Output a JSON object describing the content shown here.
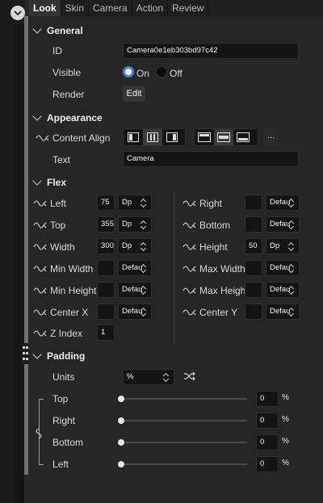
{
  "tabs": [
    "Look",
    "Skin",
    "Camera",
    "Action",
    "Review"
  ],
  "active_tab": "Look",
  "sections": {
    "general": "General",
    "appearance": "Appearance",
    "flex": "Flex",
    "padding": "Padding"
  },
  "general": {
    "id_label": "ID",
    "id_value": "Camera0e1eb303bd97c42",
    "visible_label": "Visible",
    "on_label": "On",
    "off_label": "Off",
    "render_label": "Render",
    "edit_label": "Edit"
  },
  "appearance": {
    "content_align_label": "Content Align",
    "more_label": "...",
    "text_label": "Text",
    "text_value": "Camera"
  },
  "flex": {
    "left_label": "Left",
    "left_value": "75",
    "left_unit": "Dp",
    "top_label": "Top",
    "top_value": "355",
    "top_unit": "Dp",
    "width_label": "Width",
    "width_value": "300",
    "width_unit": "Dp",
    "min_width_label": "Min Width",
    "min_width_unit": "Defau",
    "min_height_label": "Min Height",
    "min_height_unit": "Defau",
    "center_x_label": "Center X",
    "center_x_unit": "Defau",
    "z_index_label": "Z Index",
    "z_index_value": "1",
    "right_label": "Right",
    "right_unit": "Defau",
    "bottom_label": "Bottom",
    "bottom_unit": "Defau",
    "height_label": "Height",
    "height_value": "50",
    "height_unit": "Dp",
    "max_width_label": "Max Width",
    "max_width_unit": "Defau",
    "max_height_label": "Max Height",
    "max_height_unit": "Defau",
    "center_y_label": "Center Y",
    "center_y_unit": "Defau"
  },
  "padding": {
    "units_label": "Units",
    "units_value": "%",
    "top_label": "Top",
    "top_value": "0",
    "right_label": "Right",
    "right_value": "0",
    "bottom_label": "Bottom",
    "bottom_value": "0",
    "left_label": "Left",
    "left_value": "0",
    "pct": "%"
  },
  "colors": {
    "accent": "#4a7fd4",
    "bg": "#262626"
  }
}
